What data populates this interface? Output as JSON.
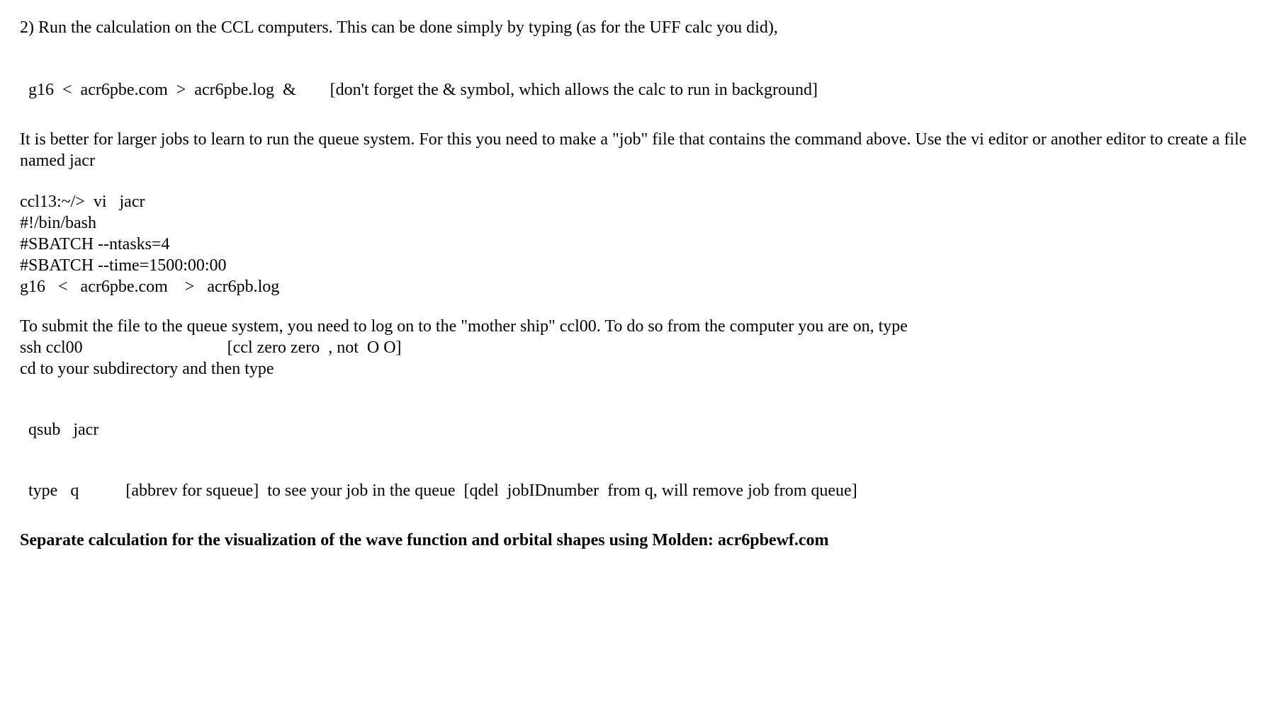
{
  "p1": "2)  Run the calculation on the CCL computers.  This can be done simply by typing (as for the UFF calc you did),",
  "p2": "g16  <  acr6pbe.com  >  acr6pbe.log  &        [don't forget the & symbol, which allows the calc to run in background]",
  "p3": "It is better for larger jobs to learn to run the queue system.  For this you need to make a \"job\" file that contains the command above.  Use the vi editor or another editor to create a file named  jacr",
  "code": {
    "l1": "ccl13:~/>  vi   jacr",
    "l2": "#!/bin/bash",
    "l3": "#SBATCH --ntasks=4",
    "l4": "#SBATCH --time=1500:00:00",
    "l5": "g16   <   acr6pbe.com    >   acr6pb.log"
  },
  "p4a": "To submit the file to the queue system, you need to log on to the \"mother ship\" ccl00.  To do so from the computer you are on, type",
  "p4b": "ssh ccl00                                  [ccl zero zero  , not  O O]",
  "p4c": "cd to your subdirectory and then type",
  "p5": "qsub   jacr",
  "p6": "type   q           [abbrev for squeue]  to see your job in the queue  [qdel  jobIDnumber  from q, will remove job from queue]",
  "p7": "Separate calculation for the visualization of the wave function and orbital shapes using Molden:   acr6pbewf.com"
}
